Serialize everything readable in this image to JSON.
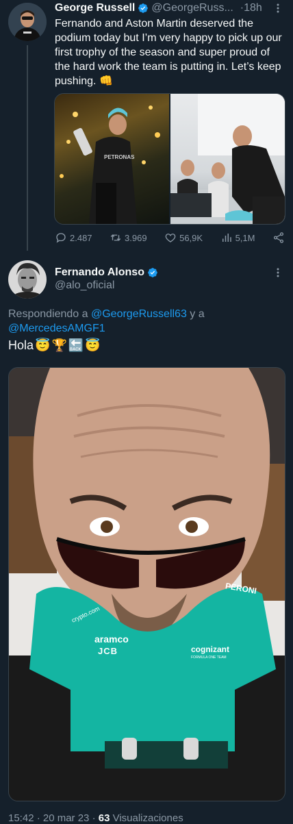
{
  "tweet1": {
    "author_name": "George Russell",
    "author_handle": "@GeorgeRuss...",
    "time": "·18h",
    "text": "Fernando and Aston Martin deserved the podium today but I’m very happy to pick up our first trophy of the season and super proud of the hard work the team is putting in. Let’s keep pushing. 👊",
    "stats": {
      "replies": "2.487",
      "retweets": "3.969",
      "likes": "56,9K",
      "views": "5,1M"
    },
    "photo_texts": {
      "petronas": "PETRONAS"
    }
  },
  "tweet2": {
    "author_name": "Fernando Alonso",
    "author_handle": "@alo_oficial",
    "replying_prefix": "Respondiendo a ",
    "reply_to_1": "@GeorgeRussell63",
    "reply_join": " y a",
    "reply_to_2": "@MercedesAMGF1",
    "text": "Hola",
    "emojis": [
      "😇",
      "🏆",
      "🔙",
      "😇"
    ],
    "photo_texts": {
      "aramco": "aramco",
      "cognizant": "cognizant",
      "formula": "FORMULA ONE TEAM",
      "peroni": "PERONI",
      "crypto": "crypto.com",
      "jcb": "JCB"
    },
    "meta_time": "15:42 · 20 mar 23 · ",
    "meta_views_count": "63",
    "meta_views_label": " Visualizaciones"
  },
  "colors": {
    "background": "#15202b",
    "text": "#f7f9f9",
    "muted": "#8b98a5",
    "link": "#1d9bf0",
    "verified": "#1d9bf0",
    "teal_shirt": "#14b5a2"
  },
  "icons": [
    "reply-icon",
    "retweet-icon",
    "like-icon",
    "views-icon",
    "share-icon",
    "more-icon",
    "verified-icon"
  ]
}
